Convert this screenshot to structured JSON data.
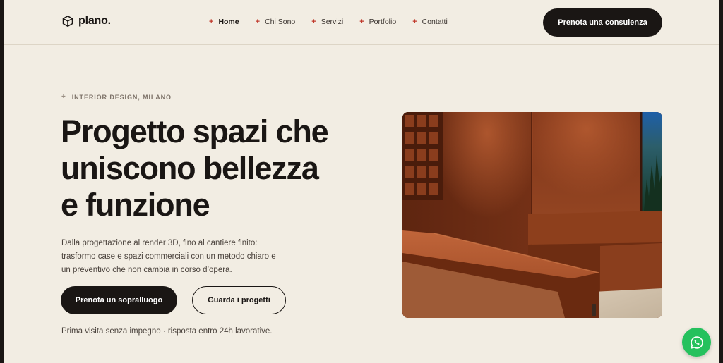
{
  "brand": {
    "name": "plano."
  },
  "nav": {
    "items": [
      {
        "label": "Home"
      },
      {
        "label": "Chi Sono"
      },
      {
        "label": "Servizi"
      },
      {
        "label": "Portfolio"
      },
      {
        "label": "Contatti"
      }
    ],
    "active": "Home",
    "cta_label": "Prenota una consulenza"
  },
  "hero": {
    "eyebrow": "INTERIOR DESIGN, MILANO",
    "title_lines": [
      "Progetto spazi che",
      "uniscono bellezza",
      "e funzione"
    ],
    "description_lines": [
      "Dalla progettazione al render 3D, fino al cantiere finito:",
      "trasformo case e spazi commerciali con un metodo chiaro e",
      "un preventivo che non cambia in corso d’opera."
    ],
    "primary_button": "Prenota un sopralluogo",
    "secondary_button": "Guarda i progetti",
    "note": "Prima visita senza impegno · risposta entro 24h lavorative."
  },
  "colors": {
    "background": "#f2ede3",
    "dark": "#1a1614",
    "accent_plus": "#c0392b",
    "whatsapp": "#25c15d",
    "terracotta": "#7a3418"
  },
  "icons": {
    "logo": "cube-icon",
    "chat": "whatsapp-icon"
  }
}
